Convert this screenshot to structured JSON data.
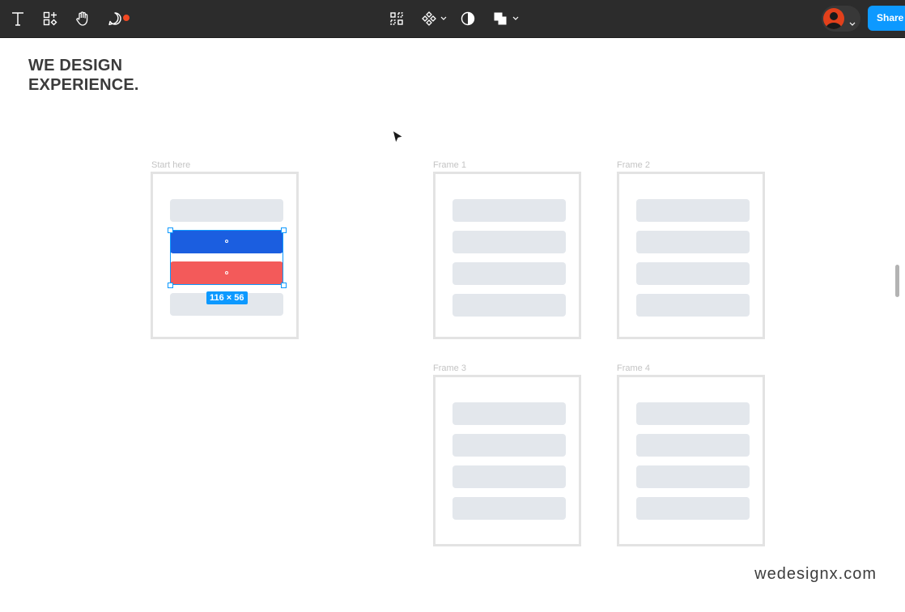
{
  "toolbar": {
    "left_tools": [
      {
        "name": "text-tool",
        "icon": "text-icon"
      },
      {
        "name": "resources-tool",
        "icon": "shapes-plus-icon"
      },
      {
        "name": "hand-tool",
        "icon": "hand-icon"
      },
      {
        "name": "comment-tool",
        "icon": "comment-icon",
        "has_notification": true
      }
    ],
    "center_tools": [
      {
        "name": "frame-selection-tool",
        "icon": "dashed-grid-icon"
      },
      {
        "name": "component-tool",
        "icon": "component-icon",
        "dropdown": true
      },
      {
        "name": "contrast-tool",
        "icon": "half-circle-icon"
      },
      {
        "name": "boolean-tool",
        "icon": "boolean-union-icon",
        "dropdown": true
      }
    ],
    "share_label": "Share",
    "avatar_icon": "user-avatar-icon",
    "colors": {
      "background": "#2c2c2c",
      "accent": "#0d99ff",
      "notification": "#f24822"
    }
  },
  "canvas": {
    "brand_line1": "WE DESIGN",
    "brand_line2": "EXPERIENCE.",
    "watermark": "wedesignx.com",
    "frames": [
      {
        "label": "Start here"
      },
      {
        "label": "Frame 1"
      },
      {
        "label": "Frame 2"
      },
      {
        "label": "Frame 3"
      },
      {
        "label": "Frame 4"
      }
    ],
    "selection_size": "116 × 56",
    "colors": {
      "primary_button": "#1b5ee0",
      "danger_button": "#f35a5a",
      "placeholder": "#e3e7ec",
      "frame_border": "#e3e3e3"
    }
  }
}
